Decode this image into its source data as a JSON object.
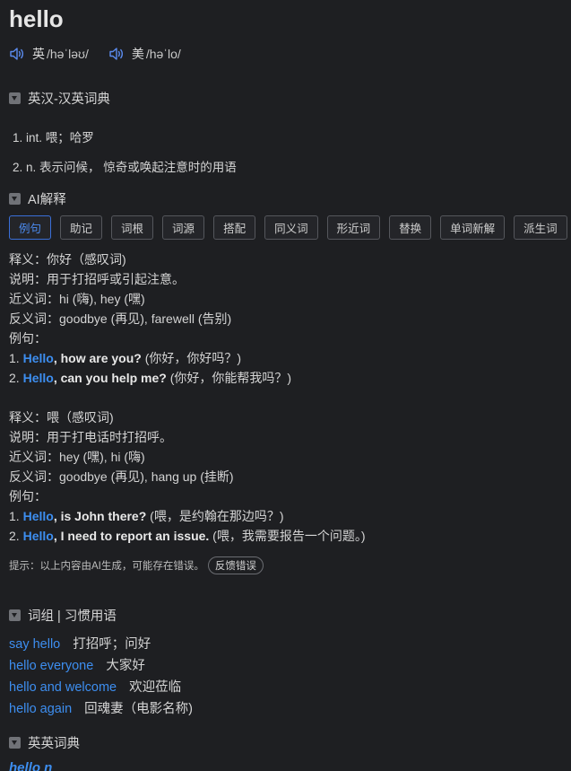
{
  "word": "hello",
  "pronunciations": [
    {
      "label": "英",
      "ipa": "/həˈləʊ/"
    },
    {
      "label": "美",
      "ipa": "/həˈlo/"
    }
  ],
  "sections": {
    "ec_dict": "英汉-汉英词典",
    "ai_explain": "AI解释",
    "phrases": "词组 | 习惯用语",
    "ee_dict": "英英词典"
  },
  "definitions": [
    "1. int. 喂；哈罗",
    "2. n. 表示问候， 惊奇或唤起注意时的用语"
  ],
  "ai_tabs": [
    "例句",
    "助记",
    "词根",
    "词源",
    "搭配",
    "同义词",
    "形近词",
    "替换",
    "单词新解",
    "派生词"
  ],
  "ai_entries": [
    {
      "meaning": "释义：你好（感叹词)",
      "explain": "说明：用于打招呼或引起注意。",
      "synonyms": "近义词：hi (嗨), hey (嘿)",
      "antonyms": "反义词：goodbye (再见), farewell (告别)",
      "examples_label": "例句：",
      "examples": [
        {
          "num": "1. ",
          "hl": "Hello",
          "en": ", how are you?",
          "zh": " (你好，你好吗？)"
        },
        {
          "num": "2. ",
          "hl": "Hello",
          "en": ", can you help me?",
          "zh": " (你好，你能帮我吗？)"
        }
      ]
    },
    {
      "meaning": "释义：喂（感叹词)",
      "explain": "说明：用于打电话时打招呼。",
      "synonyms": "近义词：hey (嘿), hi (嗨)",
      "antonyms": "反义词：goodbye (再见), hang up (挂断)",
      "examples_label": "例句：",
      "examples": [
        {
          "num": "1. ",
          "hl": "Hello",
          "en": ", is John there?",
          "zh": " (喂，是约翰在那边吗？)"
        },
        {
          "num": "2. ",
          "hl": "Hello",
          "en": ", I need to report an issue.",
          "zh": " (喂，我需要报告一个问题。)"
        }
      ]
    }
  ],
  "notice": {
    "text": "提示：以上内容由AI生成，可能存在错误。",
    "feedback": "反馈错误"
  },
  "phrases": [
    {
      "en": "say hello",
      "zh": "打招呼；问好"
    },
    {
      "en": "hello everyone",
      "zh": "大家好"
    },
    {
      "en": "hello and welcome",
      "zh": "欢迎莅临"
    },
    {
      "en": "hello again",
      "zh": "回魂妻（电影名称)"
    }
  ],
  "ee_entry": "hello n",
  "colors": {
    "background": "#1e1f22",
    "accent": "#3d8ef0",
    "text": "#d4d4d4"
  }
}
